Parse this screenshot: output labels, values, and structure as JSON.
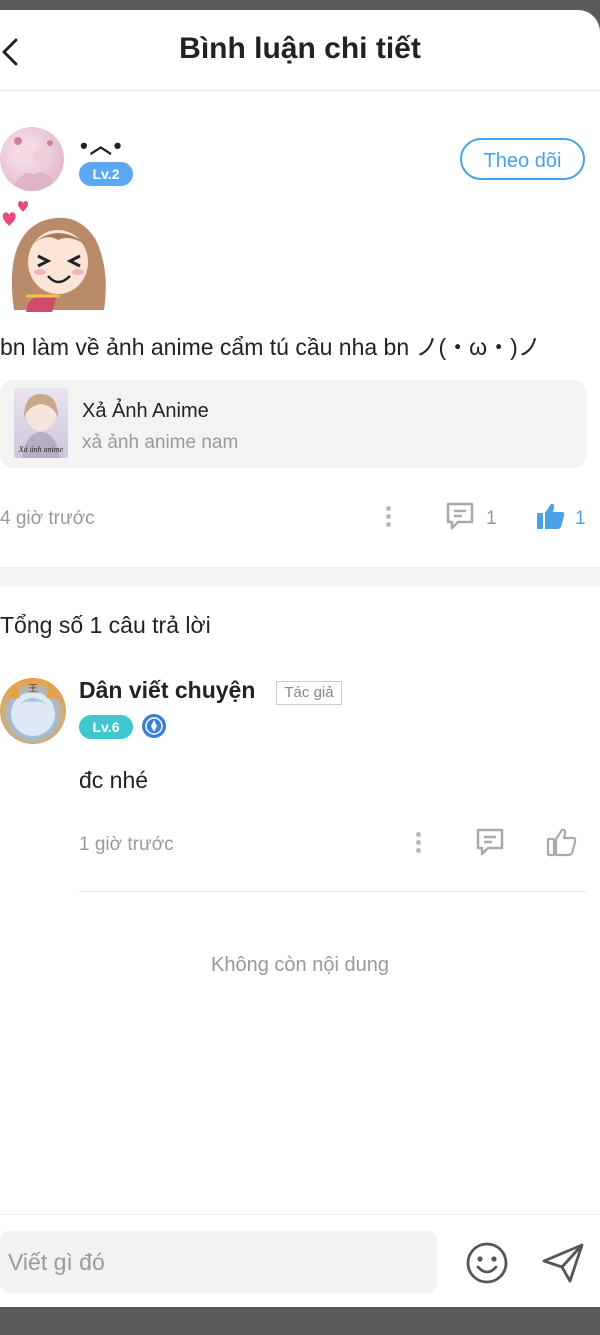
{
  "header": {
    "title": "Bình luận chi tiết"
  },
  "post": {
    "username": "•︿•",
    "level": "Lv.2",
    "follow_label": "Theo dõi",
    "text": "bn làm về ảnh anime cẩm tú cầu nha bn ノ(・ω・)ノ",
    "linked": {
      "title": "Xả Ảnh Anime",
      "subtitle": "xả ảnh anime nam",
      "thumb_caption": "Xả ảnh anime"
    },
    "time": "4 giờ trước",
    "reply_count": "1",
    "like_count": "1"
  },
  "replies_summary": "Tổng số 1 câu trả lời",
  "reply": {
    "username": "Dân viết chuyện",
    "author_tag": "Tác giả",
    "level": "Lv.6",
    "text": "đc nhé",
    "time": "1 giờ trước"
  },
  "end_text": "Không còn nội dung",
  "input": {
    "placeholder": "Viết gì đó"
  },
  "colors": {
    "accent": "#4aa1e6",
    "level_blue": "#5aa9f0",
    "level_teal": "#3fc6cf"
  },
  "icons": [
    "back-icon",
    "more-icon",
    "comment-icon",
    "thumbs-up-icon",
    "emoji-icon",
    "send-icon",
    "medal-icon"
  ]
}
